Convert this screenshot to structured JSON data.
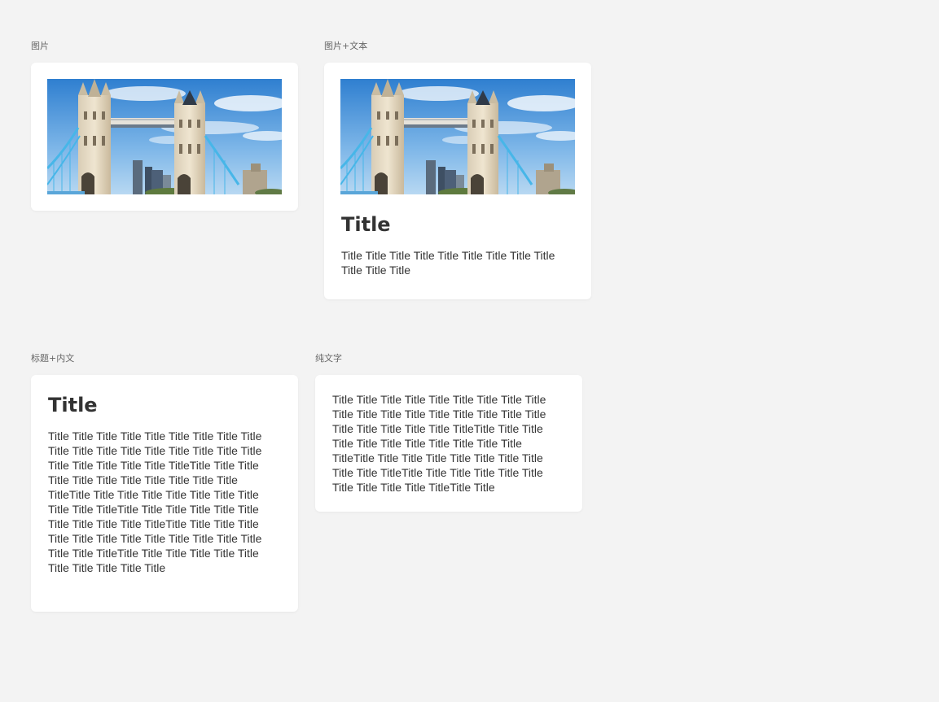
{
  "cards": [
    {
      "label": "图片",
      "image_alt": "Tower Bridge"
    },
    {
      "label": "图片+文本",
      "image_alt": "Tower Bridge",
      "title": "Title",
      "body": "Title Title Title Title Title Title Title Title Title Title Title Title"
    },
    {
      "label": "标题+内文",
      "title": "Title",
      "body": "Title Title Title Title Title Title Title Title Title Title Title Title Title Title Title Title Title Title Title Title Title Title Title TitleTitle Title Title Title Title Title Title Title Title Title Title TitleTitle Title Title Title Title Title Title Title Title Title TitleTitle Title Title Title Title Title Title Title Title Title TitleTitle Title Title Title Title Title Title Title Title Title Title Title Title Title Title TitleTitle Title Title Title Title Title Title Title Title Title Title"
    },
    {
      "label": "纯文字",
      "body": "Title Title Title Title Title Title Title Title Title Title Title Title Title Title Title Title Title Title Title Title Title Title Title TitleTitle Title Title Title Title Title Title Title Title Title Title TitleTitle Title Title Title Title Title Title Title Title Title TitleTitle Title Title Title Title Title Title Title Title Title TitleTitle Title"
    }
  ],
  "colors": {
    "page_background": "#f3f3f3",
    "card_background": "#ffffff",
    "text": "#333333",
    "label": "#666666"
  }
}
